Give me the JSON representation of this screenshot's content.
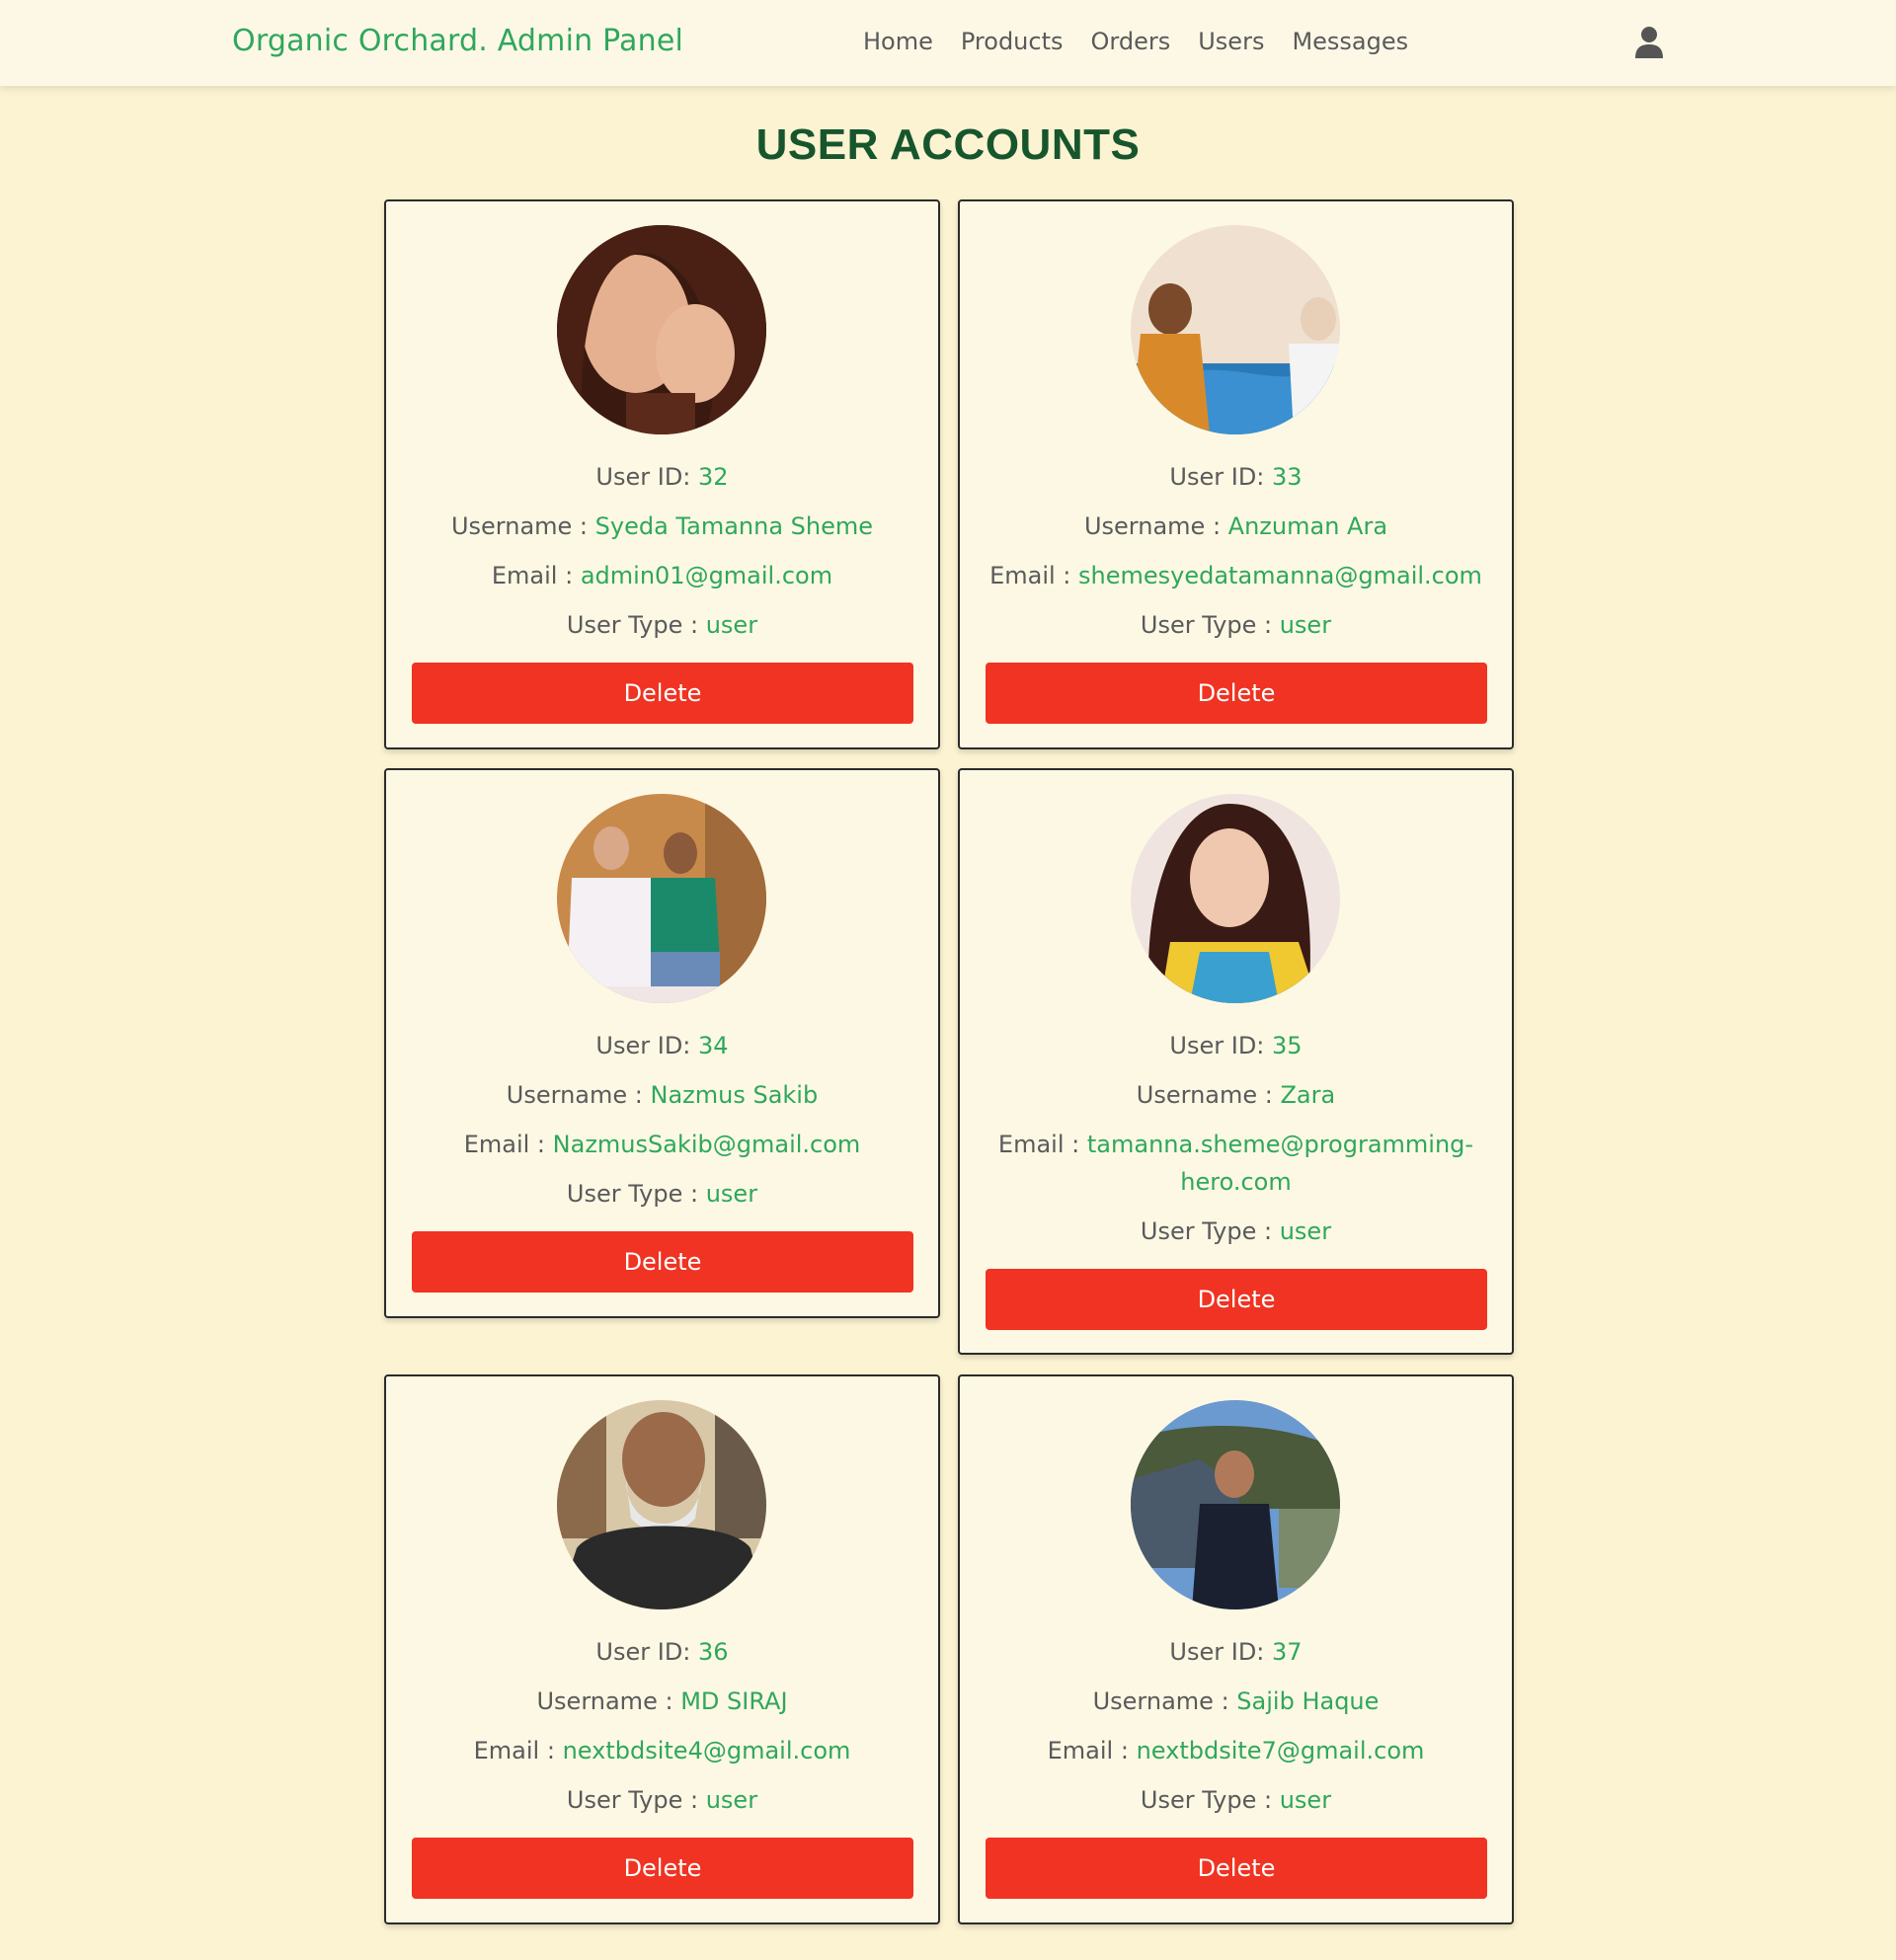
{
  "header": {
    "brand": "Organic Orchard. Admin Panel",
    "nav": [
      "Home",
      "Products",
      "Orders",
      "Users",
      "Messages"
    ],
    "user_icon": "user-icon"
  },
  "page_title": "USER ACCOUNTS",
  "labels": {
    "user_id": "User ID:",
    "username": "Username :",
    "email": "Email :",
    "user_type": "User Type :",
    "delete": "Delete"
  },
  "users": [
    {
      "id": "32",
      "username": "Syeda Tamanna Sheme",
      "email": "admin01@gmail.com",
      "type": "user"
    },
    {
      "id": "33",
      "username": "Anzuman Ara",
      "email": "shemesyedatamanna@gmail.com",
      "type": "user"
    },
    {
      "id": "34",
      "username": "Nazmus Sakib",
      "email": "NazmusSakib@gmail.com",
      "type": "user"
    },
    {
      "id": "35",
      "username": "Zara",
      "email": "tamanna.sheme@programming-",
      "email_2": "hero.com",
      "type": "user"
    },
    {
      "id": "36",
      "username": "MD SIRAJ",
      "email": "nextbdsite4@gmail.com",
      "type": "user"
    },
    {
      "id": "37",
      "username": "Sajib Haque",
      "email": "nextbdsite7@gmail.com",
      "type": "user"
    }
  ],
  "colors": {
    "background": "#fbf3d1",
    "accent": "#2fa75c",
    "title": "#17552d",
    "delete": "#f03322"
  }
}
